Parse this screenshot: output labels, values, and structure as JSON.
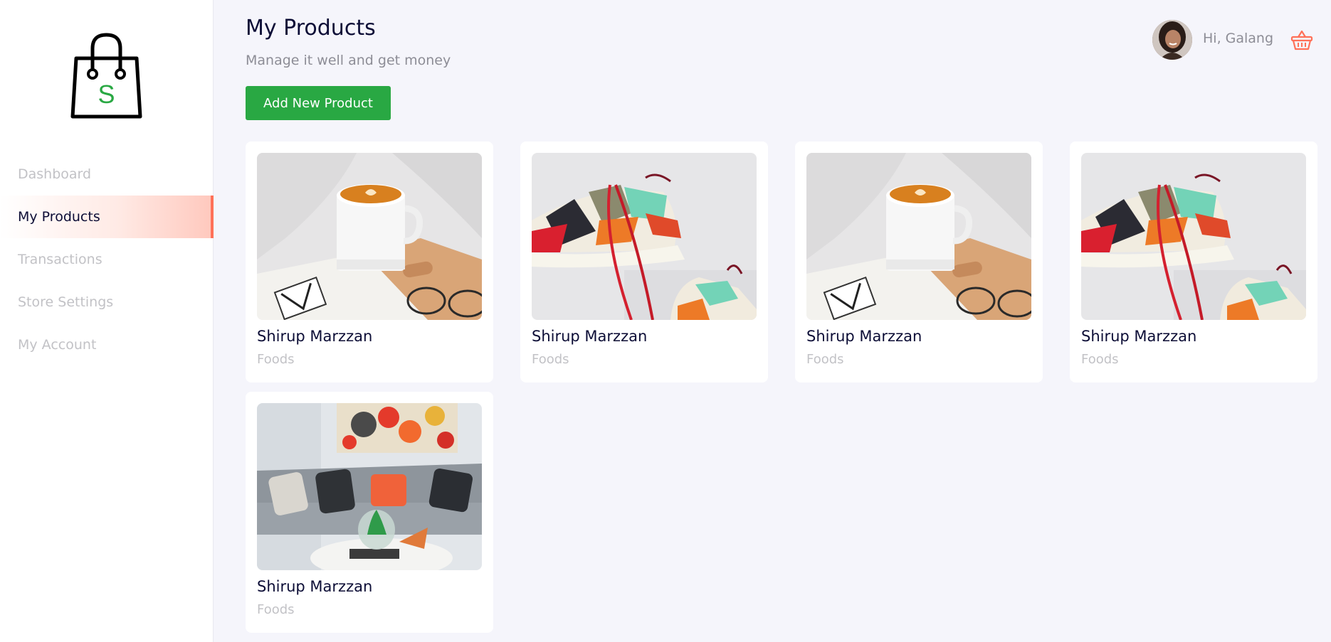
{
  "sidebar": {
    "logo_letter": "S",
    "items": [
      {
        "label": "Dashboard",
        "active": false
      },
      {
        "label": "My Products",
        "active": true
      },
      {
        "label": "Transactions",
        "active": false
      },
      {
        "label": "Store Settings",
        "active": false
      },
      {
        "label": "My Account",
        "active": false
      }
    ]
  },
  "header": {
    "title": "My Products",
    "subtitle": "Manage it well and get money",
    "add_button_label": "Add New Product"
  },
  "user": {
    "greeting": "Hi, Galang",
    "cart_icon": "basket-icon"
  },
  "products": [
    {
      "name": "Shirup Marzzan",
      "category": "Foods",
      "image": "coffee-cup-photo"
    },
    {
      "name": "Shirup Marzzan",
      "category": "Foods",
      "image": "sneakers-photo"
    },
    {
      "name": "Shirup Marzzan",
      "category": "Foods",
      "image": "coffee-cup-photo"
    },
    {
      "name": "Shirup Marzzan",
      "category": "Foods",
      "image": "sneakers-photo"
    },
    {
      "name": "Shirup Marzzan",
      "category": "Foods",
      "image": "living-room-photo"
    }
  ],
  "colors": {
    "accent": "#ff7158",
    "primary_button": "#29a843",
    "text_dark": "#0c0d36",
    "text_muted": "#c2c2c6",
    "background": "#f5f5fb"
  }
}
